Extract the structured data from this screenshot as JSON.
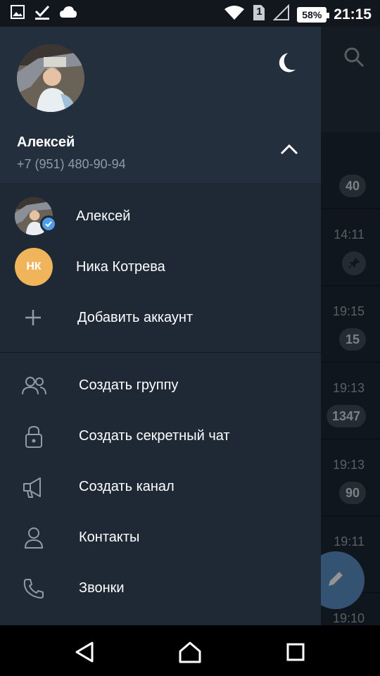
{
  "status_bar": {
    "time": "21:15",
    "battery": "58%",
    "sim_slot": "1",
    "left_icons": [
      "image-icon",
      "check-icon",
      "cloud-icon"
    ],
    "right_icons": [
      "wifi-icon",
      "sim-icon",
      "signal-icon",
      "battery-icon"
    ]
  },
  "drawer": {
    "profile": {
      "name": "Алексей",
      "phone": "+7 (951) 480-90-94"
    },
    "accounts": [
      {
        "name": "Алексей",
        "active": true
      },
      {
        "name": "Ника Котрева",
        "initials": "НК",
        "color": "#f0b45a"
      }
    ],
    "add_account_label": "Добавить аккаунт",
    "menu": [
      {
        "label": "Создать группу",
        "icon": "group-icon"
      },
      {
        "label": "Создать секретный чат",
        "icon": "lock-icon"
      },
      {
        "label": "Создать канал",
        "icon": "megaphone-icon"
      },
      {
        "label": "Контакты",
        "icon": "contact-icon"
      },
      {
        "label": "Звонки",
        "icon": "phone-icon"
      }
    ]
  },
  "background_chats": [
    {
      "time": "",
      "badge": "40"
    },
    {
      "time": "14:11",
      "badge": "",
      "pinned": true
    },
    {
      "time": "19:15",
      "badge": "15"
    },
    {
      "time": "19:13",
      "badge": "1347"
    },
    {
      "time": "19:13",
      "badge": "90"
    },
    {
      "time": "19:11",
      "badge": ""
    },
    {
      "time": "19:10",
      "badge": ""
    }
  ],
  "colors": {
    "drawer_bg": "#1f2936",
    "header_bg": "#242f3d",
    "accent": "#4e9de8",
    "fab": "#5b8fc4"
  }
}
